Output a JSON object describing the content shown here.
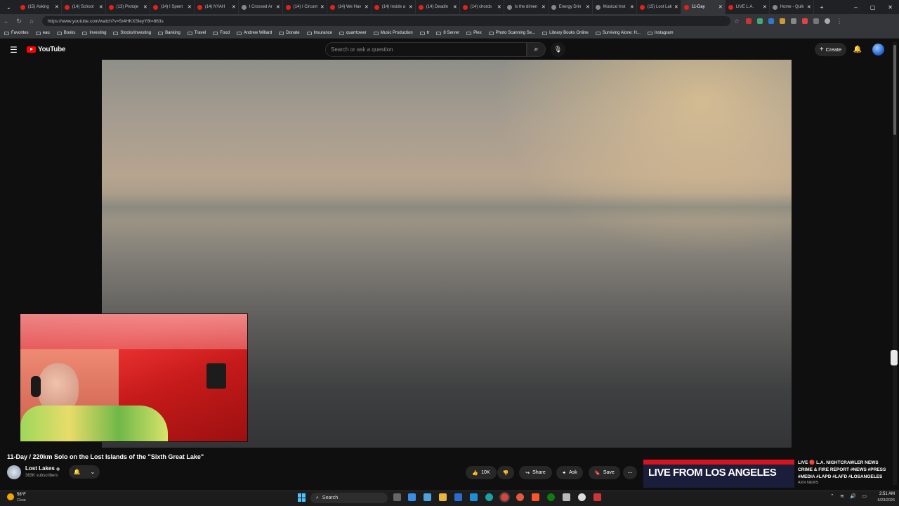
{
  "browser": {
    "tabs": [
      {
        "label": "(15) Asking",
        "icon": "youtube-icon"
      },
      {
        "label": "(14) School",
        "icon": "youtube-icon"
      },
      {
        "label": "(13) Protoje",
        "icon": "youtube-icon"
      },
      {
        "label": "(14) I Spent",
        "icon": "youtube-icon"
      },
      {
        "label": "(14) NYAH",
        "icon": "youtube-icon"
      },
      {
        "label": "I Crossed Ar",
        "icon": "page-icon"
      },
      {
        "label": "(14) I Circum",
        "icon": "youtube-icon"
      },
      {
        "label": "(14) We Hav",
        "icon": "youtube-icon"
      },
      {
        "label": "(14) Inside a",
        "icon": "youtube-icon"
      },
      {
        "label": "(14) Deadin",
        "icon": "youtube-icon"
      },
      {
        "label": "(14) chords",
        "icon": "youtube-icon"
      },
      {
        "label": "Is the dimen",
        "icon": "page-icon"
      },
      {
        "label": "Energy Drin",
        "icon": "page-icon"
      },
      {
        "label": "Musical Inst",
        "icon": "page-icon"
      },
      {
        "label": "(15) Lost Lak",
        "icon": "youtube-icon"
      },
      {
        "label": "11-Day",
        "icon": "youtube-icon",
        "active": true
      },
      {
        "label": "LIVE L.A.",
        "icon": "youtube-icon"
      },
      {
        "label": "Home - Quik",
        "icon": "page-icon"
      }
    ],
    "new_tab": "+",
    "window_controls": [
      "–",
      "▢",
      "✕"
    ],
    "url": "https://www.youtube.com/watch?v=5r4HKXSleyY8t=863s",
    "bookmarks": [
      "Favorites",
      "eau",
      "Books",
      "Investing",
      "Stocks/Investing",
      "Banking",
      "Travel",
      "Food",
      "Andrew Willard",
      "Donate",
      "Insurance",
      "quarrtower",
      "Music Production",
      "tr",
      "8 Server",
      "Plex",
      "Photo Scanning Se...",
      "Library Books Online",
      "Surviving Alone: H...",
      "Instagram"
    ]
  },
  "youtube": {
    "logo_text": "YouTube",
    "search_placeholder": "Search or ask a question",
    "create_label": "Create",
    "video": {
      "title": "11-Day / 220km Solo on the Lost Islands of the \"Sixth Great Lake\"",
      "channel": "Lost Lakes",
      "subscribers": "383K subscribers",
      "likes": "10K",
      "share_label": "Share",
      "ask_label": "Ask",
      "save_label": "Save"
    },
    "live_suggestion": {
      "thumb_text": "LIVE FROM LOS ANGELES",
      "title": "LIVE 🔴 L.A. NIGHTCRAWLER NEWS CRIME & FIRE REPORT #NEWS #PRESS #MEDIA #LAPD #LAFD #LOSANGELES",
      "channel": "AXN NEWS"
    }
  },
  "taskbar": {
    "weather_temp": "58°F",
    "weather_desc": "Clear",
    "search_label": "Search",
    "time": "2:51 AM",
    "date": "6/23/2026"
  },
  "colors": {
    "youtube_red": "#ff0000",
    "background": "#0f0f0f",
    "live_red": "#d7141d"
  }
}
